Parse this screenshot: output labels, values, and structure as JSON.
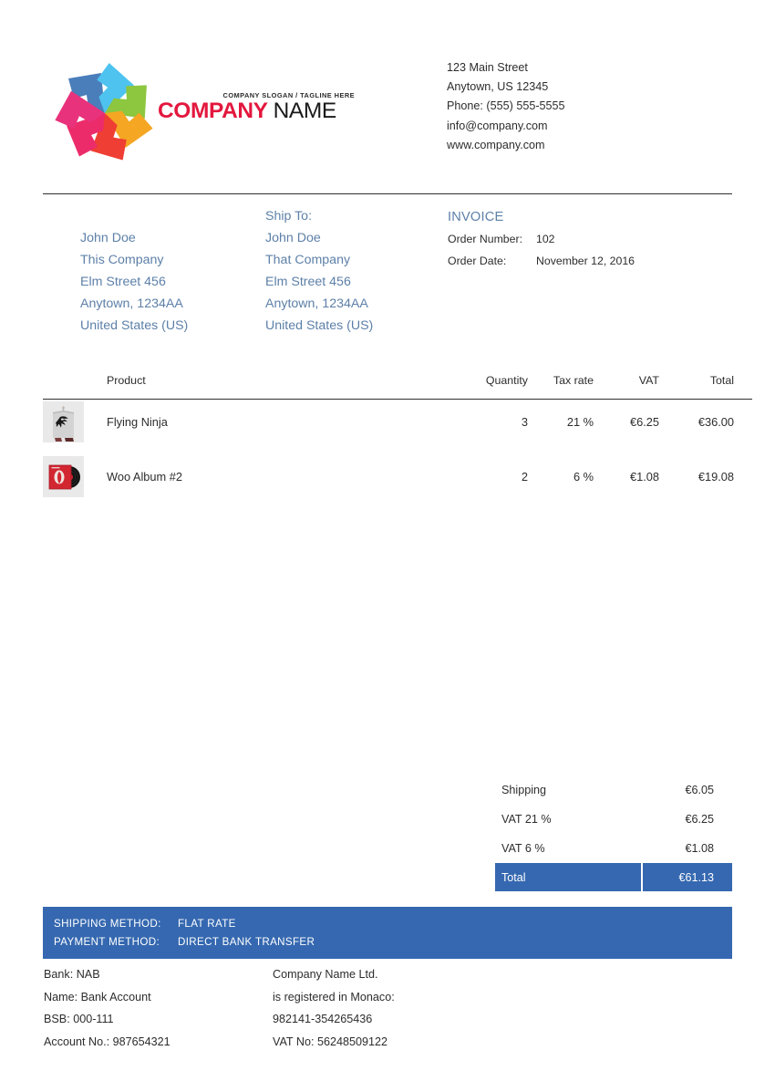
{
  "document": {
    "type": "invoice",
    "page_background": "#ffffff"
  },
  "colors": {
    "accent_blue": "#3568b0",
    "address_blue": "#5d80a8",
    "logo_red": "#e3173e",
    "text": "#2d2d2d",
    "rule": "#2f2f2f"
  },
  "header": {
    "logo": {
      "icon": "pinwheel-logo-icon",
      "slogan": "COMPANY SLOGAN / TAGLINE HERE",
      "name_primary": "COMPANY",
      "name_secondary": "NAME",
      "petal_colors": [
        "#e8327c",
        "#4a7ebb",
        "#4ec3ef",
        "#8dc63f",
        "#f5a623",
        "#ef3e33",
        "#ec2c6a"
      ]
    },
    "company_address": [
      "123 Main Street",
      "Anytown, US 12345",
      "Phone: (555) 555-5555",
      "info@company.com",
      "www.company.com"
    ]
  },
  "parties": {
    "bill_to": {
      "label": "",
      "lines": [
        "John Doe",
        "This Company",
        "Elm Street 456",
        "Anytown, 1234AA",
        "United States (US)"
      ]
    },
    "ship_to": {
      "label": "Ship To:",
      "lines": [
        "John Doe",
        "That Company",
        "Elm Street 456",
        "Anytown, 1234AA",
        "United States (US)"
      ]
    },
    "invoice": {
      "title": "INVOICE",
      "order_number_label": "Order Number:",
      "order_number_value": "102",
      "order_date_label": "Order Date:",
      "order_date_value": "November 12, 2016"
    }
  },
  "items_table": {
    "columns": {
      "thumb": "",
      "product": "Product",
      "quantity": "Quantity",
      "tax_rate": "Tax rate",
      "vat": "VAT",
      "total": "Total"
    },
    "rows": [
      {
        "thumbnail": "tshirt-ninja-thumbnail",
        "product": "Flying Ninja",
        "quantity": "3",
        "tax_rate": "21 %",
        "vat": "€6.25",
        "total": "€36.00"
      },
      {
        "thumbnail": "vinyl-album-thumbnail",
        "product": "Woo Album #2",
        "quantity": "2",
        "tax_rate": "6 %",
        "vat": "€1.08",
        "total": "€19.08"
      }
    ]
  },
  "totals": {
    "rows": [
      {
        "label": "Shipping",
        "value": "€6.05"
      },
      {
        "label": "VAT 21 %",
        "value": "€6.25"
      },
      {
        "label": "VAT 6 %",
        "value": "€1.08"
      }
    ],
    "grand": {
      "label": "Total",
      "value": "€61.13"
    }
  },
  "banner": {
    "shipping_method_label": "SHIPPING METHOD:",
    "shipping_method_value": "FLAT RATE",
    "payment_method_label": "PAYMENT METHOD:",
    "payment_method_value": "DIRECT BANK TRANSFER"
  },
  "footer": {
    "left": [
      "Bank: NAB",
      "Name: Bank Account",
      "BSB: 000-111",
      "Account No.: 987654321"
    ],
    "right": [
      "Company Name Ltd.",
      "is registered in Monaco:",
      "982141-354265436",
      "VAT No: 56248509122"
    ]
  }
}
